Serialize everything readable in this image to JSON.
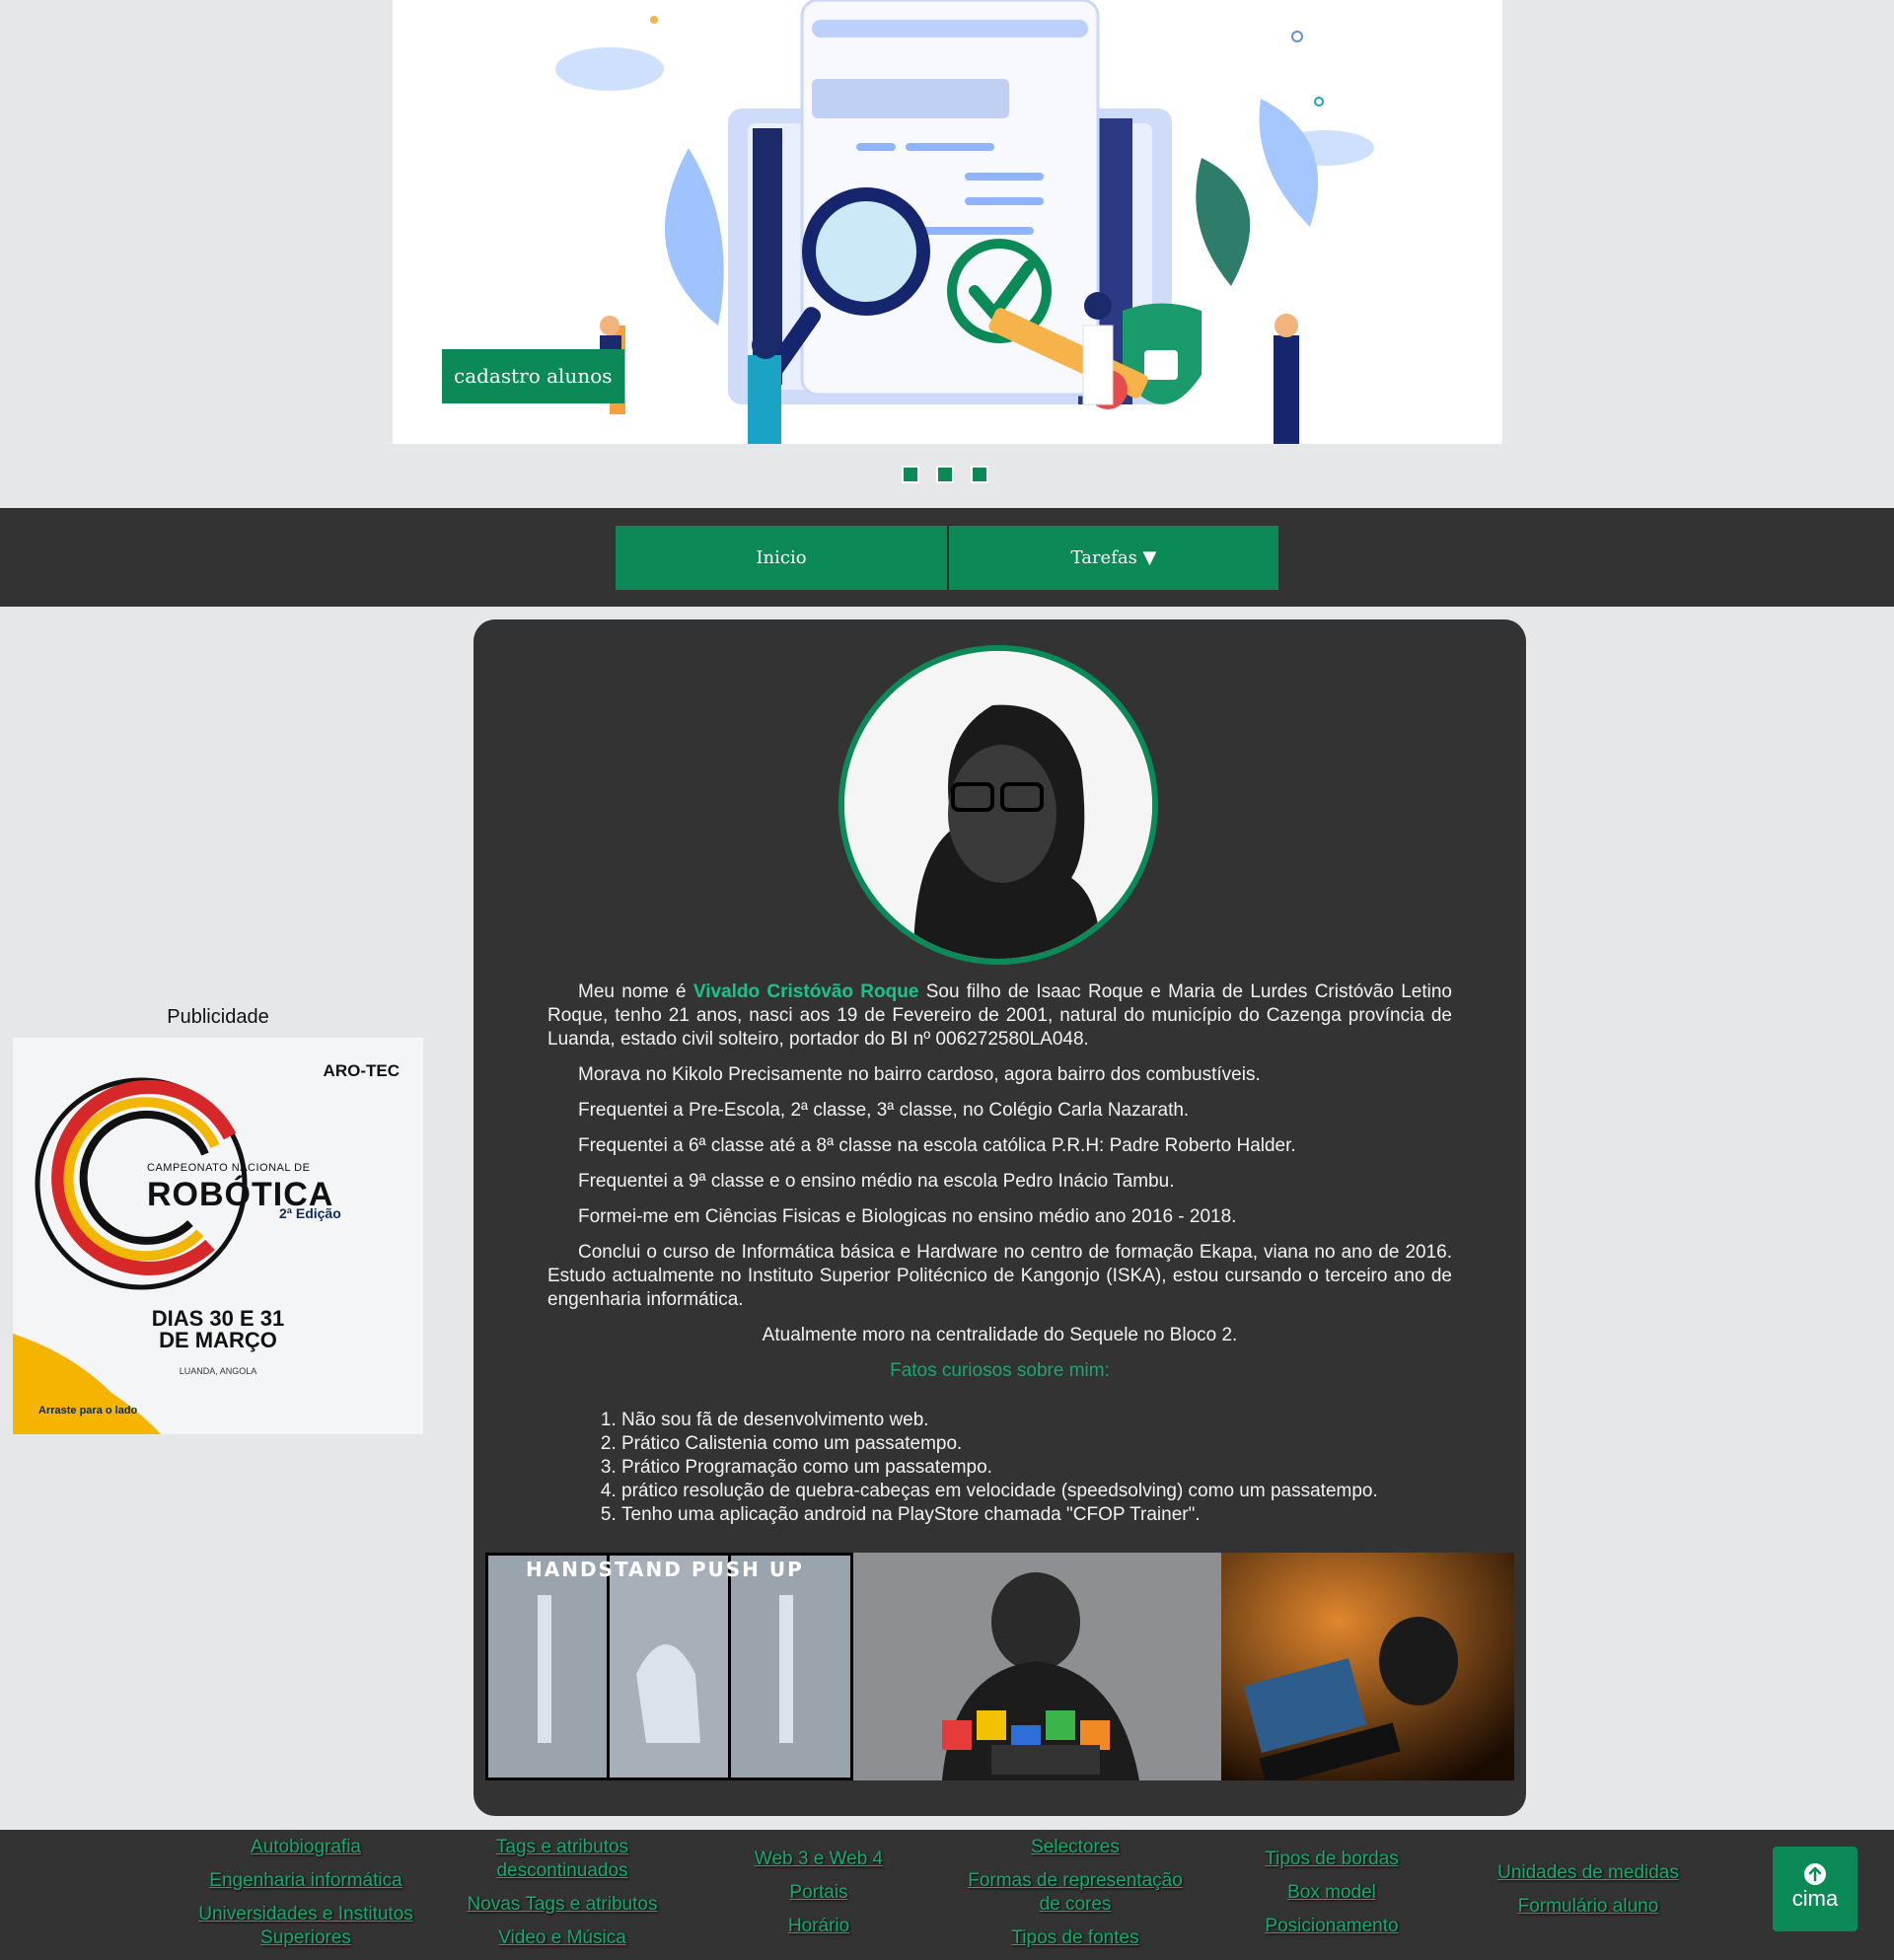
{
  "banner": {
    "caption": "cadastro alunos",
    "dots": 3
  },
  "nav": {
    "inicio": "Inicio",
    "tarefas": "Tarefas ▼"
  },
  "ad": {
    "label": "Publicidade",
    "brand": "ARO-TEC",
    "line1": "CAMPEONATO   NACIONAL DE",
    "line2": "ROBÓTICA",
    "line3": "2ª Edição",
    "line4a": "DIAS 30 E 31",
    "line4b": "DE MARÇO",
    "line5": "LUANDA, ANGOLA",
    "line6": "Arraste para o lado"
  },
  "bio": {
    "p1_pre": "Meu nome é ",
    "p1_name": "Vivaldo Cristóvão Roque",
    "p1_post": " Sou filho de Isaac Roque e Maria de Lurdes Cristóvão Letino Roque, tenho 21 anos, nasci aos 19 de Fevereiro de 2001, natural do município do Cazenga província de Luanda, estado civil solteiro, portador do BI nº 006272580LA048.",
    "p2": "Morava no Kikolo Precisamente no bairro cardoso, agora bairro dos combustíveis.",
    "p3": "Frequentei a Pre-Escola, 2ª classe, 3ª classe, no Colégio Carla Nazarath.",
    "p4": "Frequentei a 6ª classe até a 8ª classe na escola católica P.R.H: Padre Roberto Halder.",
    "p5": "Frequentei a 9ª classe e o ensino médio na escola Pedro Inácio Tambu.",
    "p6": "Formei-me em Ciências Fisicas e Biologicas no ensino médio ano 2016 - 2018.",
    "p7": "Conclui o curso de Informática básica e Hardware no centro de formação Ekapa, viana no ano de 2016. Estudo actualmente no Instituto Superior Politécnico de Kangonjo (ISKA), estou cursando o terceiro ano de engenharia informática.",
    "p8": "Atualmente moro na centralidade do Sequele no Bloco 2.",
    "fatos": "Fatos curiosos sobre mim:",
    "facts": [
      "Não sou fã de desenvolvimento web.",
      "Prático Calistenia como um passatempo.",
      "Prático Programação como um passatempo.",
      "prático resolução de quebra-cabeças em velocidade (speedsolving) como um passatempo.",
      "Tenho uma aplicação android na PlayStore chamada \"CFOP Trainer\"."
    ],
    "photo1_title": "HANDSTAND PUSH UP"
  },
  "footer": {
    "col1": [
      "Autobiografia",
      "Engenharia informática",
      "Universidades e Institutos Superiores"
    ],
    "col2": [
      "Tags e atributos descontinuados",
      "Novas Tags e atributos",
      "Video e Música"
    ],
    "col3": [
      "Web 3 e Web 4",
      "Portais",
      "Horário"
    ],
    "col4": [
      "Selectores",
      "Formas de representação de cores",
      "Tipos de fontes"
    ],
    "col5": [
      "Tipos de bordas",
      "Box model",
      "Posicionamento"
    ],
    "col6": [
      "Unidades de medidas",
      "Formulário aluno"
    ],
    "cima": "cima"
  },
  "colors": {
    "accent": "#0b8a57",
    "highlight": "#19c48a",
    "dark": "#333333",
    "page_bg": "#e6e7e8"
  }
}
